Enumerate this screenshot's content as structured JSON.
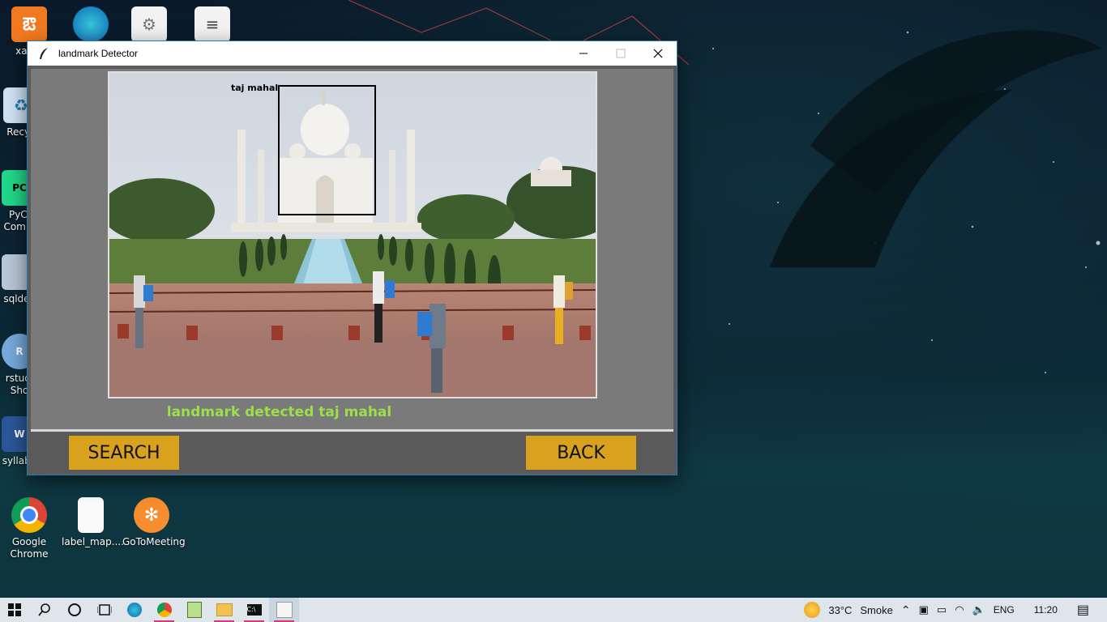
{
  "window": {
    "title": "landmark Detector",
    "image_caption": "taj mahal",
    "status_text": "landmark detected taj mahal",
    "search_label": "SEARCH",
    "back_label": "BACK"
  },
  "desktop_icons": [
    {
      "label": "xamp",
      "icon": "xampp-icon"
    },
    {
      "label": "Recyc",
      "icon": "recycle-bin-icon"
    },
    {
      "label": "PyCl\nComm",
      "icon": "pycharm-icon"
    },
    {
      "label": "sqldev",
      "icon": "sqldeveloper-icon"
    },
    {
      "label": "rstudi\nSho",
      "icon": "rstudio-icon"
    },
    {
      "label": "syllabu",
      "icon": "word-icon"
    },
    {
      "label": "Google\nChrome",
      "icon": "chrome-icon"
    },
    {
      "label": "label_map....",
      "icon": "file-icon"
    },
    {
      "label": "GoToMeeting",
      "icon": "gotomeeting-icon"
    }
  ],
  "taskbar": {
    "weather_temp": "33°C",
    "weather_text": "Smoke",
    "language": "ENG",
    "time": "11:20"
  },
  "colors": {
    "button_bg": "#d9a21e",
    "status_text": "#9be04a",
    "window_bg": "#5a5a5a"
  }
}
